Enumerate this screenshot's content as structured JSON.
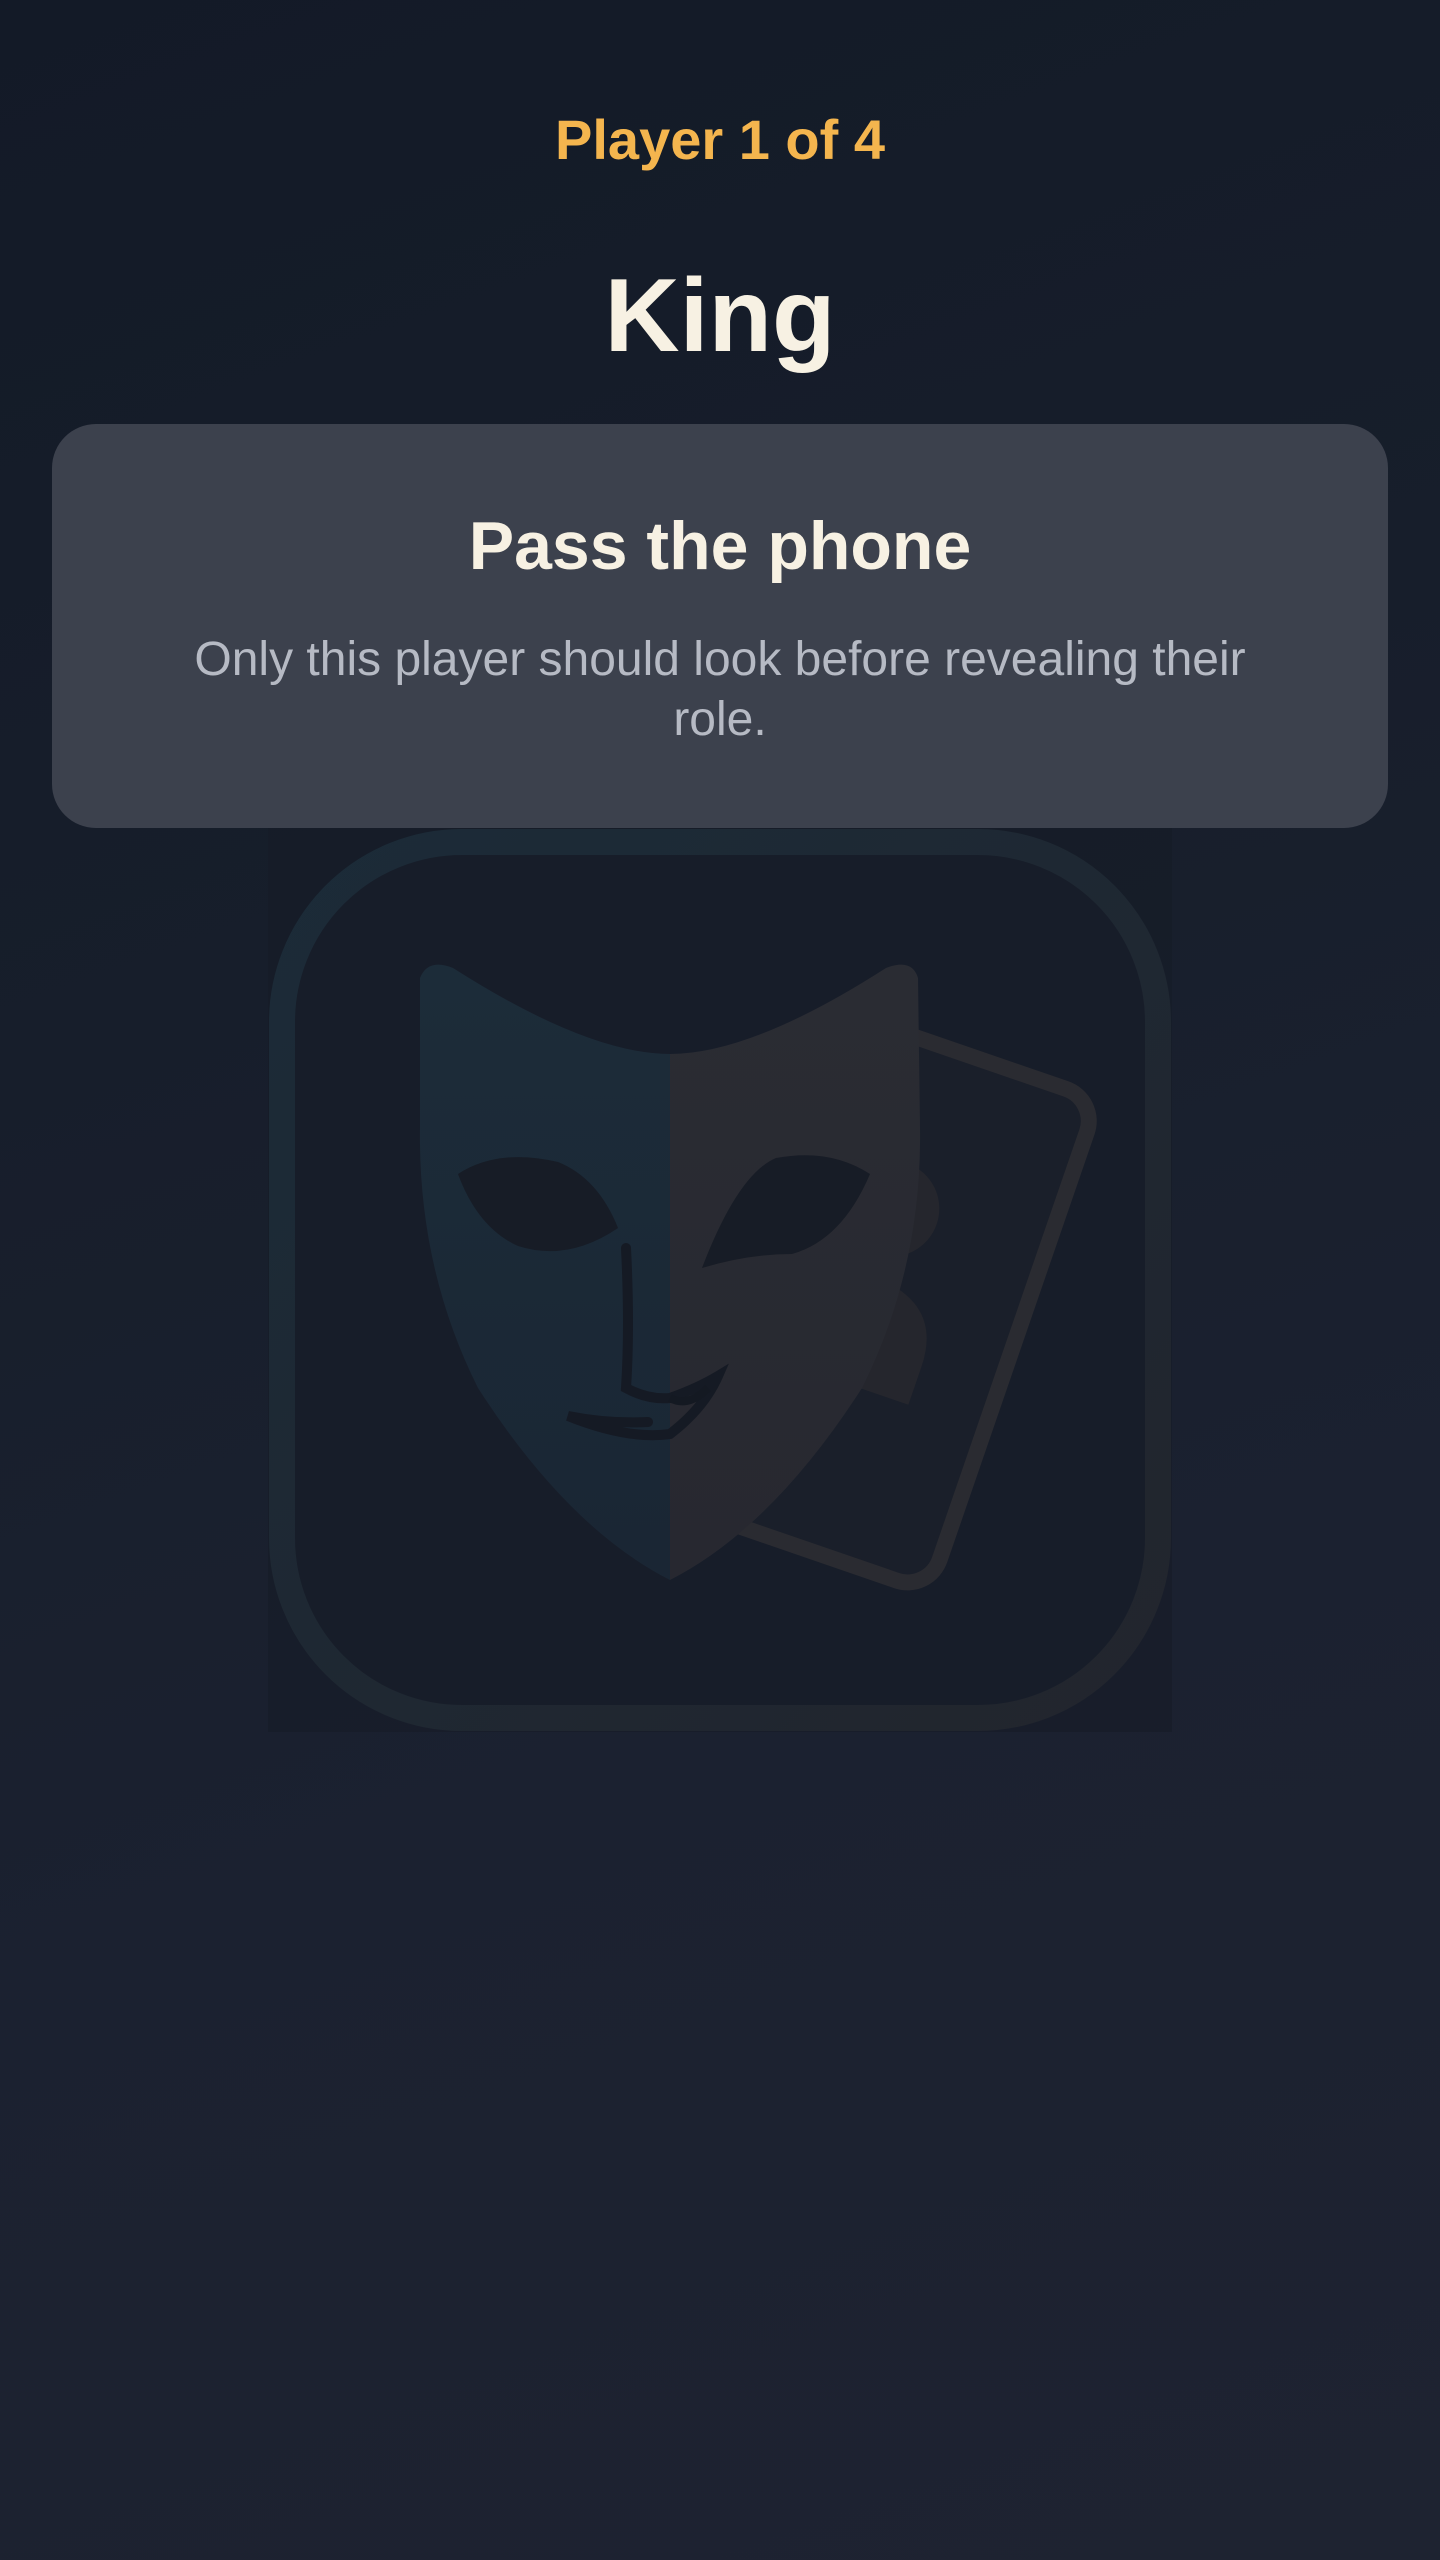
{
  "header": {
    "player_counter": "Player 1 of 4",
    "role_name": "King"
  },
  "pass_card": {
    "title": "Pass the phone",
    "description": "Only this player should look before revealing their role."
  },
  "illustration": {
    "icon": "theater-mask-card-icon"
  },
  "colors": {
    "accent": "#f4b54e",
    "title_text": "#f7f1e3",
    "card_bg": "#3c414d",
    "muted_text": "#b6bac4",
    "background": "#161c29"
  }
}
